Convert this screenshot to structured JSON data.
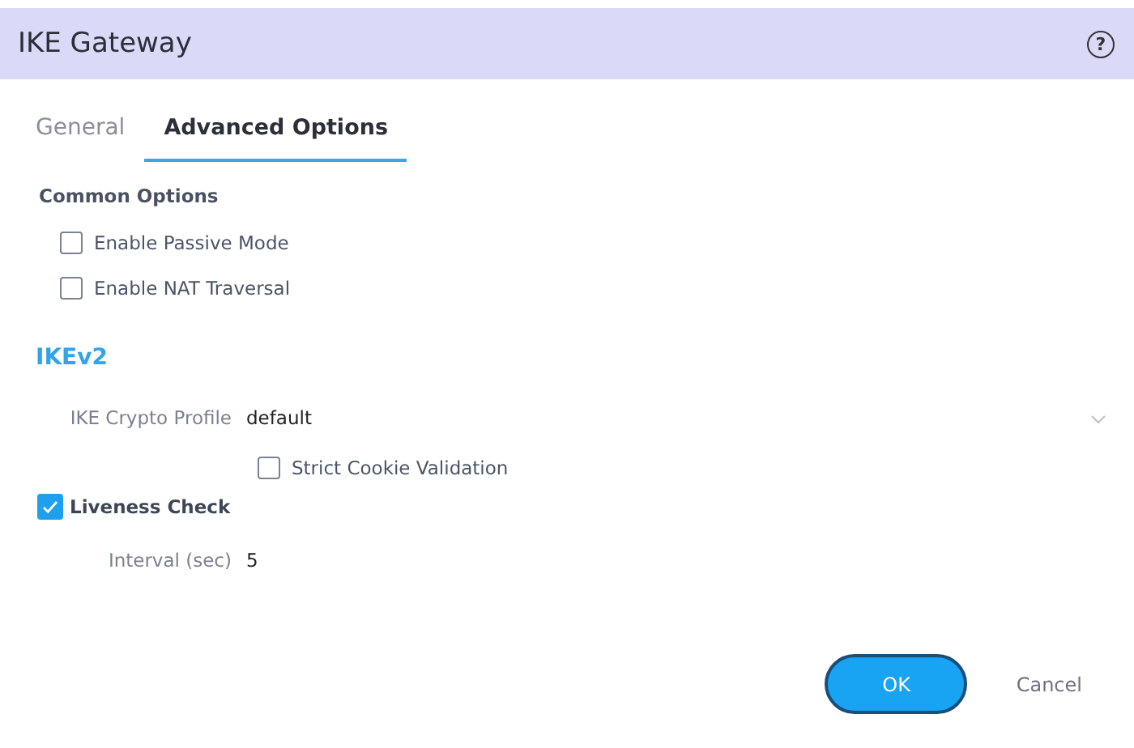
{
  "window": {
    "title": "IKE Gateway",
    "help": "?"
  },
  "tabs": [
    {
      "label": "General",
      "selected": false
    },
    {
      "label": "Advanced Options",
      "selected": true
    }
  ],
  "common_options": {
    "heading": "Common Options",
    "checkboxes": [
      {
        "label": "Enable Passive Mode",
        "checked": false
      },
      {
        "label": "Enable NAT Traversal",
        "checked": false
      }
    ]
  },
  "ikev2": {
    "heading": "IKEv2",
    "crypto_profile": {
      "label": "IKE Crypto Profile",
      "value": "default"
    },
    "strict_cookie": {
      "label": "Strict Cookie Validation",
      "checked": false
    },
    "liveness": {
      "label": "Liveness Check",
      "checked": true
    },
    "interval": {
      "label": "Interval (sec)",
      "value": "5"
    }
  },
  "buttons": [
    {
      "label": "OK",
      "kind": "primary"
    },
    {
      "label": "Cancel",
      "kind": "link"
    }
  ]
}
